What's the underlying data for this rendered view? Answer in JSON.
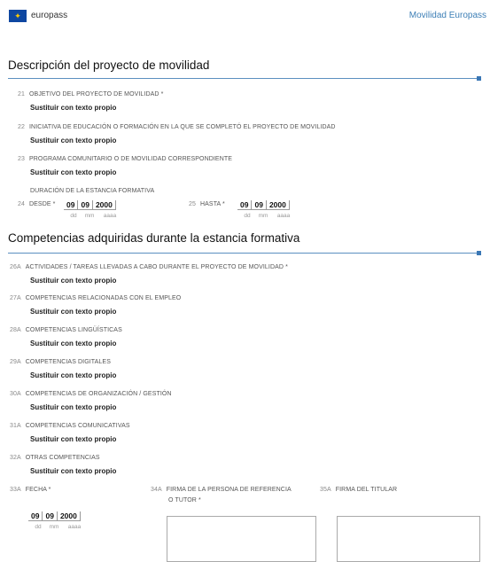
{
  "header": {
    "brand": "europass",
    "right_title": "Movilidad Europass"
  },
  "section1": {
    "title": "Descripción del proyecto de movilidad",
    "fields": [
      {
        "num": "21",
        "label": "OBJETIVO DEL PROYECTO DE MOVILIDAD *",
        "value": "Sustituir con texto propio"
      },
      {
        "num": "22",
        "label": "INICIATIVA DE EDUCACIÓN O FORMACIÓN EN LA QUE SE COMPLETÓ EL PROYECTO DE MOVILIDAD",
        "value": "Sustituir con texto propio"
      },
      {
        "num": "23",
        "label": "PROGRAMA COMUNITARIO O DE MOVILIDAD CORRESPONDIENTE",
        "value": "Sustituir con texto propio"
      }
    ],
    "duration_label": "DURACIÓN DE LA ESTANCIA FORMATIVA",
    "from": {
      "num": "24",
      "label": "DESDE *",
      "dd": "09",
      "mm": "09",
      "yyyy": "2000"
    },
    "to": {
      "num": "25",
      "label": "HASTA *",
      "dd": "09",
      "mm": "09",
      "yyyy": "2000"
    },
    "date_hints": {
      "dd": "dd",
      "mm": "mm",
      "yyyy": "aaaa"
    }
  },
  "section2": {
    "title": "Competencias adquiridas durante la estancia formativa",
    "fields": [
      {
        "num": "26A",
        "label": "ACTIVIDADES / TAREAS LLEVADAS A CABO DURANTE EL PROYECTO DE MOVILIDAD *",
        "value": "Sustituir con texto propio"
      },
      {
        "num": "27A",
        "label": "COMPETENCIAS RELACIONADAS CON EL EMPLEO",
        "value": "Sustituir con texto propio"
      },
      {
        "num": "28A",
        "label": "COMPETENCIAS LINGÜÍSTICAS",
        "value": "Sustituir con texto propio"
      },
      {
        "num": "29A",
        "label": "COMPETENCIAS DIGITALES",
        "value": "Sustituir con texto propio"
      },
      {
        "num": "30A",
        "label": "COMPETENCIAS DE ORGANIZACIÓN / GESTIÓN",
        "value": "Sustituir con texto propio"
      },
      {
        "num": "31A",
        "label": "COMPETENCIAS COMUNICATIVAS",
        "value": "Sustituir con texto propio"
      },
      {
        "num": "32A",
        "label": "OTRAS COMPETENCIAS",
        "value": "Sustituir con texto propio"
      }
    ],
    "fecha": {
      "num": "33A",
      "label": "FECHA *",
      "dd": "09",
      "mm": "09",
      "yyyy": "2000"
    },
    "sig_ref": {
      "num": "34A",
      "label_line1": "FIRMA DE LA PERSONA DE REFERENCIA",
      "label_line2": "O TUTOR *"
    },
    "sig_holder": {
      "num": "35A",
      "label": "FIRMA DEL TITULAR"
    }
  }
}
